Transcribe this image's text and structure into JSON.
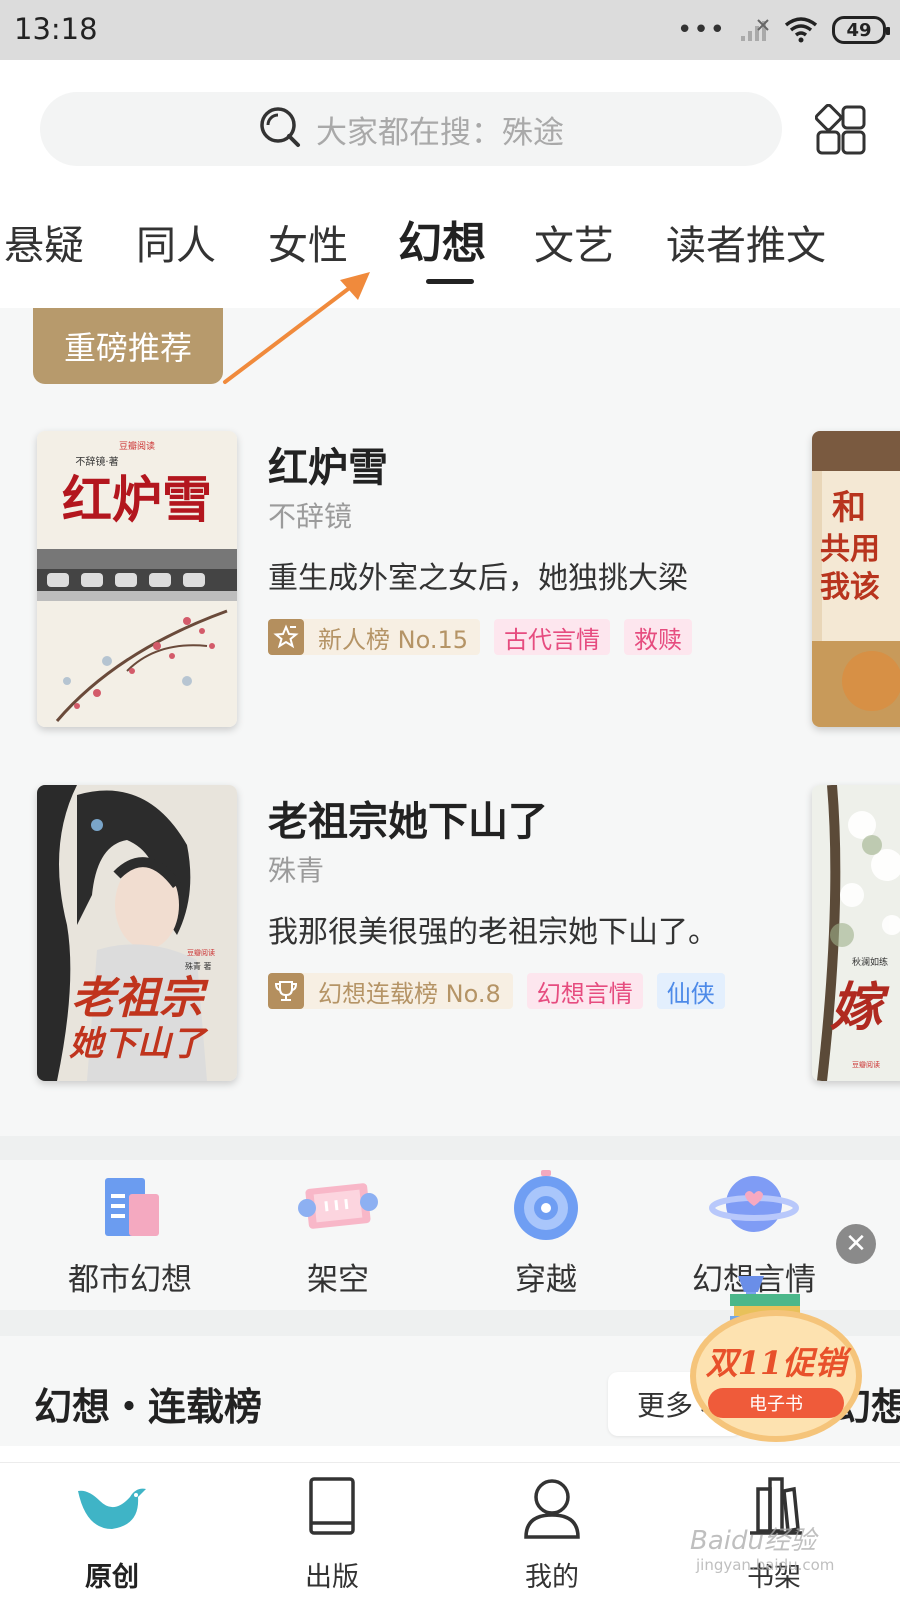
{
  "status_bar": {
    "time": "13:18",
    "battery": "49"
  },
  "search": {
    "placeholder": "大家都在搜：殊途"
  },
  "tabs": [
    {
      "label": "悬疑"
    },
    {
      "label": "同人"
    },
    {
      "label": "女性"
    },
    {
      "label": "幻想",
      "active": true
    },
    {
      "label": "文艺"
    },
    {
      "label": "读者推文"
    }
  ],
  "recommend": {
    "badge": "重磅推荐",
    "books": [
      {
        "title": "红炉雪",
        "author": "不辞镜",
        "desc": "重生成外室之女后，她独挑大梁",
        "rank": "新人榜 No.15",
        "tags": [
          "古代言情",
          "救赎"
        ],
        "cover": {
          "title": "红炉雪",
          "author": "不辞镜·著",
          "publisher": "豆瓣阅读"
        },
        "side_cover": {
          "text": "和\n共用\n我该"
        }
      },
      {
        "title": "老祖宗她下山了",
        "author": "殊青",
        "desc": "我那很美很强的老祖宗她下山了。",
        "rank": "幻想连载榜 No.8",
        "tags": [
          "幻想言情",
          "仙侠"
        ],
        "cover": {
          "title_line1": "老祖宗",
          "title_line2": "她下山了",
          "author": "殊青 著",
          "publisher": "豆瓣阅读"
        },
        "side_cover": {
          "text": "嫁",
          "author": "秋澜如练",
          "publisher": "豆瓣阅读"
        }
      }
    ]
  },
  "categories": [
    {
      "label": "都市幻想",
      "icon": "city-book-icon"
    },
    {
      "label": "架空",
      "icon": "scroll-icon"
    },
    {
      "label": "穿越",
      "icon": "portal-icon"
    },
    {
      "label": "幻想言情",
      "icon": "planet-icon"
    }
  ],
  "ranking": {
    "title": "幻想・连载榜",
    "more": "更多",
    "next_title": "幻想"
  },
  "promo": {
    "title": "双11促销",
    "subtitle": "电子书"
  },
  "bottom_nav": [
    {
      "label": "原创",
      "active": true
    },
    {
      "label": "出版"
    },
    {
      "label": "我的"
    },
    {
      "label": "书架"
    }
  ],
  "watermark": {
    "main": "Baidu经验",
    "sub": "jingyan.baidu.com"
  },
  "colors": {
    "accent_gold": "#b79a6c",
    "tag_pink": "#e64c7f",
    "tag_blue": "#4d8ae8",
    "arrow": "#f08a3c",
    "brand_teal": "#3fb4c6"
  }
}
